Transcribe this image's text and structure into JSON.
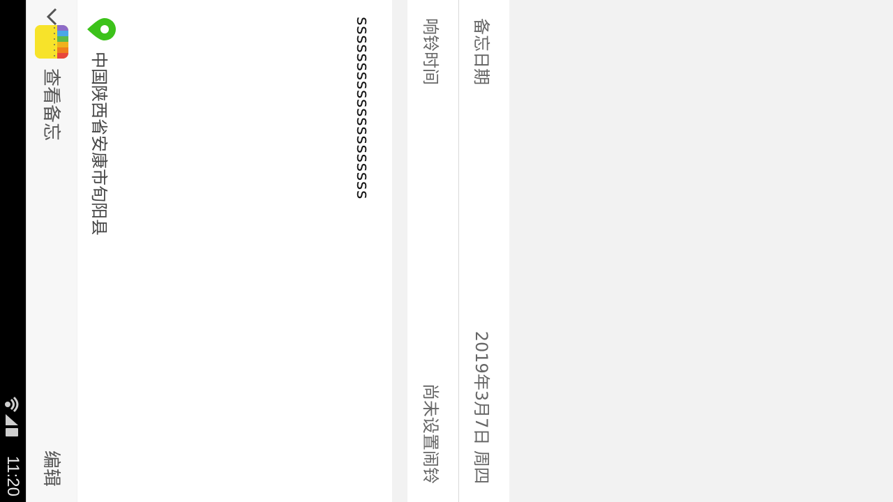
{
  "status_bar": {
    "time": "11:20",
    "icons": [
      "wifi-icon",
      "signal-icon",
      "battery-icon"
    ]
  },
  "header": {
    "back_icon": "chevron-down-icon",
    "logo": "app-logo",
    "title": "查看备忘",
    "edit_label": "编辑"
  },
  "note": {
    "content": "ssssssssssssssssssss",
    "location_icon": "location-pin-icon",
    "location": "中国陕西省安康市旬阳县"
  },
  "details": {
    "date_label": "备忘日期",
    "date_value": "2019年3月7日 周四",
    "alarm_label": "响铃时间",
    "alarm_value": "尚未设置闹铃"
  },
  "colors": {
    "accent_green": "#3cc21a",
    "background": "#f2f2f2",
    "status_bar": "#000000"
  }
}
